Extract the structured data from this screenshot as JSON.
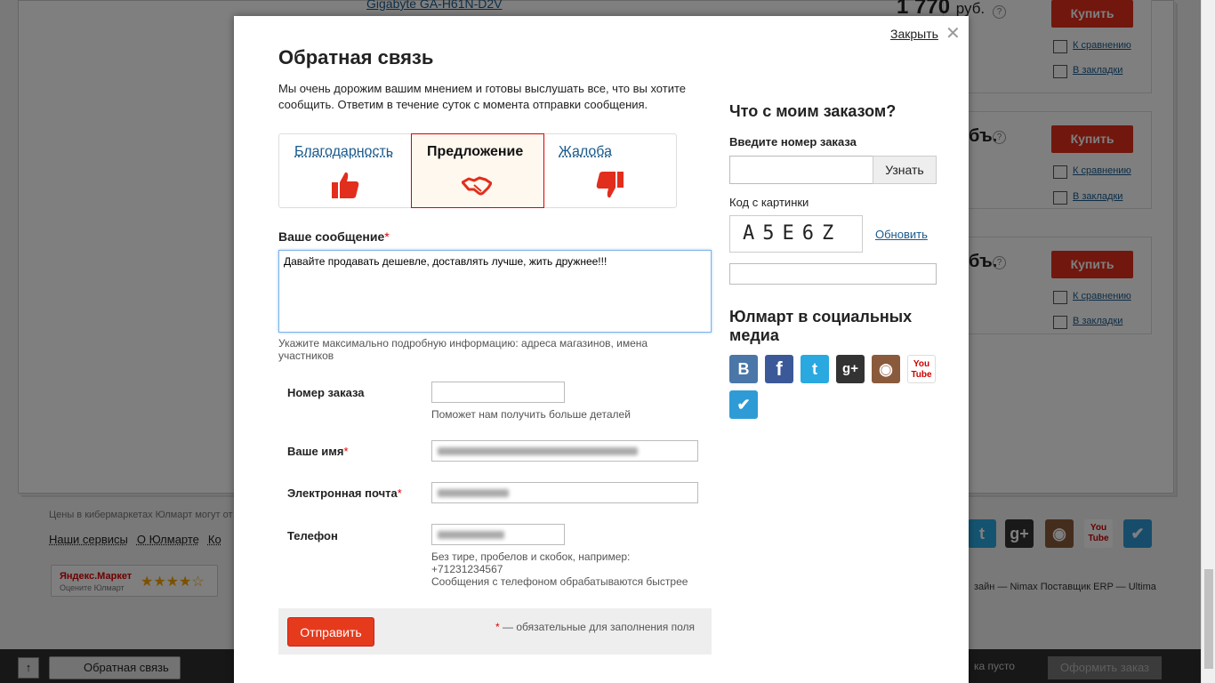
{
  "background": {
    "product_name": "Gigabyte GA-H61N-D2V",
    "price": "1 770",
    "currency": "руб.",
    "currency_partial": "бъ.",
    "buy_label": "Купить",
    "compare_label": "К сравнению",
    "bookmark_label": "В закладки",
    "footer_note": "Цены в кибермаркетах Юлмарт могут от",
    "footer_nav": [
      "Наши сервисы",
      "О Юлмарте",
      "Ко"
    ],
    "yandex_market_title": "Яндекс.Маркет",
    "yandex_market_sub": "Оцените Юлмарт",
    "yandex_stars": "★★★★☆",
    "credits": "зайн — Nimax  Поставщик ERP — Ultima"
  },
  "bottombar": {
    "up_label": "↑",
    "feedback_label": "Обратная связь",
    "cart_label": "ка пусто",
    "order_label": "Оформить заказ"
  },
  "modal": {
    "close_label": "Закрыть",
    "close_x": "✕",
    "title": "Обратная связь",
    "intro": "Мы очень дорожим вашим мнением и готовы выслушать все, что вы хотите сообщить. Ответим в течение суток с момента отправки сообщения.",
    "tabs": [
      {
        "label": "Благодарность",
        "icon": "thumbs-up-icon"
      },
      {
        "label": "Предложение",
        "icon": "handshake-icon"
      },
      {
        "label": "Жалоба",
        "icon": "thumbs-down-icon"
      }
    ],
    "message_label": "Ваше сообщение",
    "required_mark": "*",
    "message_value": "Давайте продавать дешевле, доставлять лучше, жить дружнее!!!",
    "message_hint": "Укажите максимально подробную информацию: адреса магазинов, имена участников",
    "order_label": "Номер заказа",
    "order_hint": "Поможет нам получить больше деталей",
    "name_label": "Ваше имя",
    "email_label": "Электронная почта",
    "phone_label": "Телефон",
    "phone_hint": "Без тире, пробелов и скобок, например: +71231234567",
    "phone_hint2": "Сообщения с телефоном обрабатываются быстрее",
    "submit_label": "Отправить",
    "required_note": "— обязательные для заполнения поля",
    "side": {
      "order_title": "Что с моим заказом?",
      "order_input_label": "Введите номер заказа",
      "order_button": "Узнать",
      "captcha_label": "Код с картинки",
      "captcha_text": "A5E6Z",
      "refresh_label": "Обновить",
      "social_title": "Юлмарт в социальных медиа",
      "social": [
        {
          "name": "vkontakte-icon",
          "glyph": "B",
          "color": "#4a76a8"
        },
        {
          "name": "facebook-icon",
          "glyph": "f",
          "color": "#3b5998"
        },
        {
          "name": "twitter-icon",
          "glyph": "t",
          "color": "#2aa9e0"
        },
        {
          "name": "google-plus-icon",
          "glyph": "g+",
          "color": "#333333"
        },
        {
          "name": "instagram-icon",
          "glyph": "◉",
          "color": "#8a5a3c"
        },
        {
          "name": "youtube-icon",
          "glyph": "You Tube",
          "color": "#ffffff"
        },
        {
          "name": "foursquare-icon",
          "glyph": "✔",
          "color": "#2e9bd6"
        }
      ]
    }
  }
}
